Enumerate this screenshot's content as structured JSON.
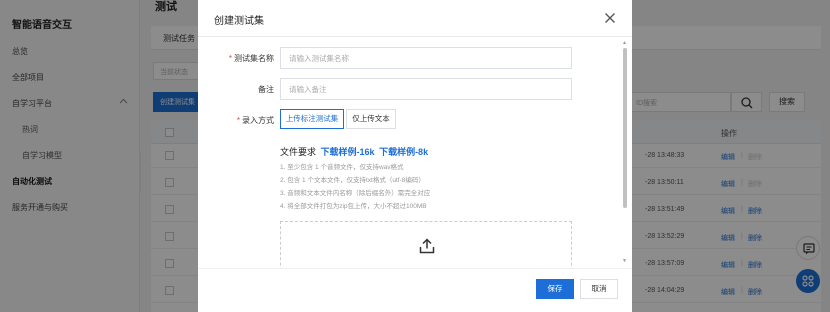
{
  "sidebar": {
    "brand": "智能语音交互",
    "items": [
      {
        "label": "总览"
      },
      {
        "label": "全部项目"
      },
      {
        "label": "自学习平台"
      },
      {
        "label": "热词"
      },
      {
        "label": "自学习模型"
      },
      {
        "label": "自动化测试"
      },
      {
        "label": "服务开通与购买"
      }
    ]
  },
  "main": {
    "page_heading": "测试",
    "tab_label": "测试任务",
    "filter_placeholder": "当前状态",
    "create_button": "创建测试集",
    "search_placeholder": "ID搜索",
    "search_button": "搜索",
    "table": {
      "op_header": "操作",
      "edit_label": "编辑",
      "delete_label": "删除",
      "rows": [
        {
          "time": "-28 13:48:33",
          "delete_enabled": false
        },
        {
          "time": "-28 13:50:11",
          "delete_enabled": false
        },
        {
          "time": "-28 13:51:49",
          "delete_enabled": true
        },
        {
          "time": "-28 13:52:29",
          "delete_enabled": true
        },
        {
          "time": "-28 13:57:09",
          "delete_enabled": true
        },
        {
          "time": "-28 14:04:29",
          "delete_enabled": true
        }
      ]
    }
  },
  "modal": {
    "title": "创建测试集",
    "name_label": "测试集名称",
    "name_placeholder": "请输入测试集名称",
    "note_label": "备注",
    "note_placeholder": "请输入备注",
    "mode_label": "录入方式",
    "mode_options": [
      "上传标注测试集",
      "仅上传文本"
    ],
    "mode_selected": "上传标注测试集",
    "requirements_title": "文件要求",
    "sample_16k": "下载样例-16k",
    "sample_8k": "下载样例-8k",
    "requirements": [
      "1. 至少包含 1 个音频文件，仅支持wav格式",
      "2. 包含 1 个文本文件，仅支持txt格式（utf-8编码）",
      "3. 音频和文本文件内名称（除后缀名外）需完全对应",
      "4. 将全部文件打包为zip包上传，大小不超过100MB"
    ],
    "save_button": "保存",
    "cancel_button": "取消"
  },
  "colors": {
    "accent": "#1d6fd7",
    "required": "#e8413c",
    "brand_bar": "#e8552b"
  },
  "icons": {
    "close": "close-icon",
    "upload": "upload-icon",
    "search": "search-icon",
    "chat": "chat-icon",
    "apps": "apps-icon"
  }
}
